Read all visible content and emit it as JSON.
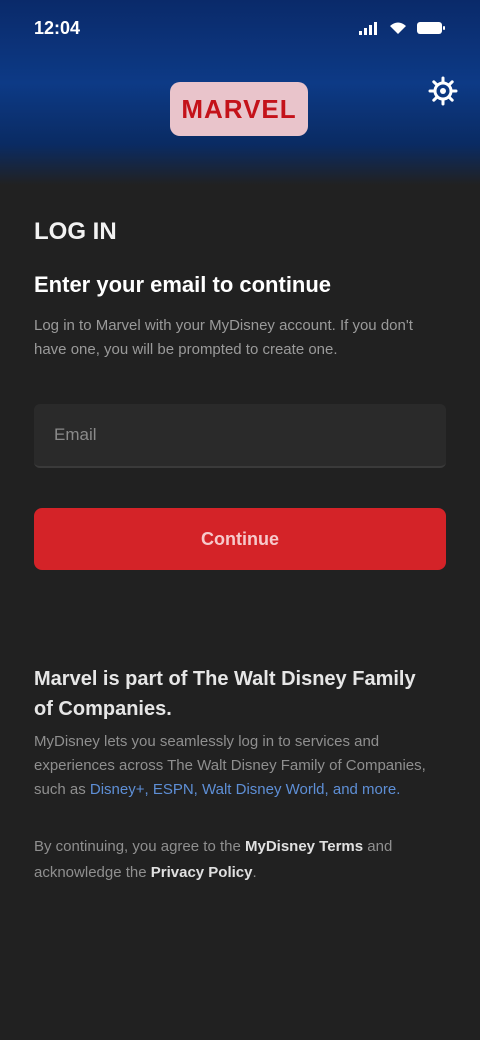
{
  "status_bar": {
    "time": "12:04"
  },
  "header": {
    "logo_text": "MARVEL"
  },
  "colors": {
    "brand_red": "#d42328",
    "header_blue": "#0d3a86",
    "background": "#212121",
    "link_blue": "#5e8fd6"
  },
  "icons": {
    "settings": "gear-icon",
    "signal": "signal-icon",
    "wifi": "wifi-icon",
    "battery": "battery-icon"
  },
  "main": {
    "eyebrow": "LOG IN",
    "headline": "Enter your email to continue",
    "description": "Log in to Marvel with your MyDisney account. If you don't have one, you will be prompted to create one.",
    "email_field": {
      "placeholder": "Email",
      "value": ""
    },
    "continue_label": "Continue"
  },
  "info": {
    "title": "Marvel is part of The Walt Disney Family of Companies.",
    "body_prefix": "MyDisney lets you seamlessly log in to services and experiences across The Walt Disney Family of Companies, such as ",
    "body_link": "Disney+, ESPN, Walt Disney World, and more.",
    "terms_prefix": "By continuing, you agree to the ",
    "terms_link": "MyDisney Terms",
    "terms_mid": " and acknowledge the ",
    "terms_link2": "Privacy Policy",
    "terms_suffix": "."
  }
}
